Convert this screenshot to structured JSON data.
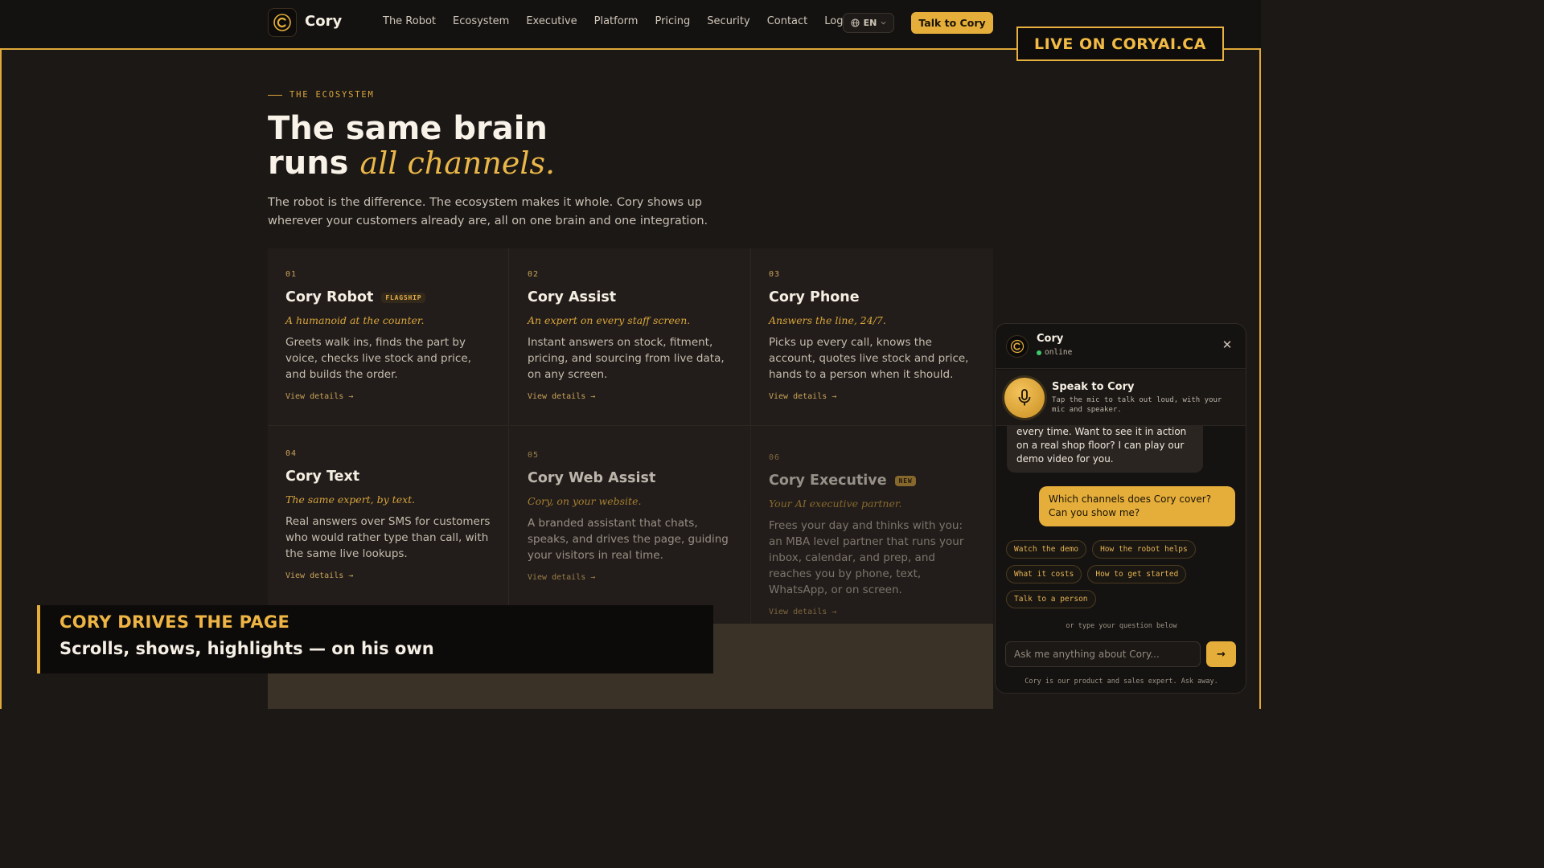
{
  "nav": {
    "brand": "Cory",
    "links": [
      "The Robot",
      "Ecosystem",
      "Executive",
      "Platform",
      "Pricing",
      "Security",
      "Contact",
      "Log in"
    ],
    "language": "EN",
    "cta": "Talk to Cory"
  },
  "live_badge": "LIVE ON CORYAI.CA",
  "hero": {
    "eyebrow": "THE ECOSYSTEM",
    "headline_line1": "The same brain",
    "headline_line2_plain": "runs",
    "headline_line2_accent": "all channels.",
    "lede": "The robot is the difference. The ecosystem makes it whole. Cory shows up wherever your customers already are, all on one brain and one integration."
  },
  "cards": [
    {
      "num": "01",
      "title": "Cory Robot",
      "tag": "FLAGSHIP",
      "sub": "A humanoid at the counter.",
      "desc": "Greets walk ins, finds the part by voice, checks live stock and price, and builds the order.",
      "link": "View details →"
    },
    {
      "num": "02",
      "title": "Cory Assist",
      "tag": "",
      "sub": "An expert on every staff screen.",
      "desc": "Instant answers on stock, fitment, pricing, and sourcing from live data, on any screen.",
      "link": "View details →"
    },
    {
      "num": "03",
      "title": "Cory Phone",
      "tag": "",
      "sub": "Answers the line, 24/7.",
      "desc": "Picks up every call, knows the account, quotes live stock and price, hands to a person when it should.",
      "link": "View details →"
    },
    {
      "num": "04",
      "title": "Cory Text",
      "tag": "",
      "sub": "The same expert, by text.",
      "desc": "Real answers over SMS for customers who would rather type than call, with the same live lookups.",
      "link": "View details →"
    },
    {
      "num": "05",
      "title": "Cory Web Assist",
      "tag": "",
      "sub": "Cory, on your website.",
      "desc": "A branded assistant that chats, speaks, and drives the page, guiding your visitors in real time.",
      "link": "View details →"
    },
    {
      "num": "06",
      "title": "Cory Executive",
      "tag": "NEW",
      "sub": "Your AI executive partner.",
      "desc": "Frees your day and thinks with you: an MBA level partner that runs your inbox, calendar, and prep, and reaches you by phone, text, WhatsApp, or on screen.",
      "link": "View details →"
    }
  ],
  "caption": {
    "line1": "CORY DRIVES THE PAGE",
    "line2": "Scrolls, shows, highlights — on his own"
  },
  "chat": {
    "name": "Cory",
    "status": "online",
    "speak_title": "Speak to Cory",
    "speak_sub": "Tap the mic to talk out loud, with your mic and speaker.",
    "bot_message": "every time. Want to see it in action on a real shop floor? I can play our demo video for you.",
    "user_message": "Which channels does Cory cover? Can you show me?",
    "chips": [
      "Watch the demo",
      "How the robot helps",
      "What it costs",
      "How to get started",
      "Talk to a person"
    ],
    "or_type": "or type your question below",
    "input_placeholder": "Ask me anything about Cory...",
    "send": "→",
    "footnote": "Cory is our product and sales expert. Ask away."
  },
  "colors": {
    "accent": "#e5ae3a",
    "background": "#1c1816",
    "nav": "#141211"
  }
}
